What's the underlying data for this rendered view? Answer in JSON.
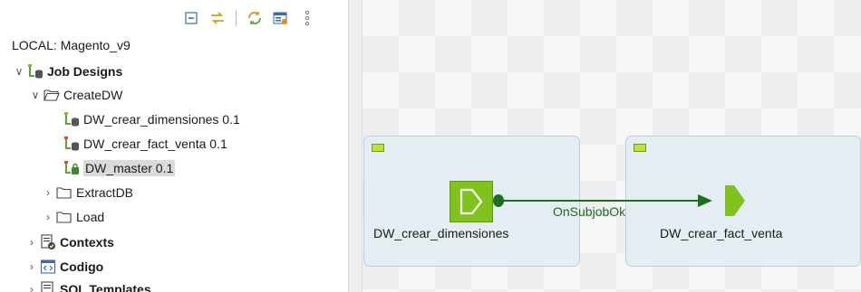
{
  "repository": {
    "project_label": "LOCAL: Magento_v9",
    "toolbar": [
      {
        "name": "collapse-all-icon"
      },
      {
        "name": "sync-link-icon"
      },
      {
        "name": "refresh-icon"
      },
      {
        "name": "view-menu-icon"
      },
      {
        "name": "more-options-icon"
      }
    ],
    "tree": [
      {
        "label": "Job Designs",
        "icon": "job-designs-icon",
        "bold": true,
        "expanded": true
      },
      {
        "label": "CreateDW",
        "icon": "folder-open-icon",
        "expanded": true
      },
      {
        "label": "DW_crear_dimensiones 0.1",
        "icon": "job-icon"
      },
      {
        "label": "DW_crear_fact_venta 0.1",
        "icon": "job-icon"
      },
      {
        "label": "DW_master 0.1",
        "icon": "job-locked-icon",
        "selected": true
      },
      {
        "label": "ExtractDB",
        "icon": "folder-icon",
        "expanded": false
      },
      {
        "label": "Load",
        "icon": "folder-icon",
        "expanded": false
      },
      {
        "label": "Contexts",
        "icon": "contexts-icon",
        "bold": true,
        "expanded": false
      },
      {
        "label": "Codigo",
        "icon": "code-icon",
        "bold": true,
        "expanded": false
      },
      {
        "label": "SQL Templates",
        "icon": "sql-templates-icon",
        "bold": true,
        "expanded": false
      }
    ]
  },
  "canvas": {
    "components": [
      {
        "label": "DW_crear_dimensiones",
        "selected": true
      },
      {
        "label": "DW_crear_fact_venta",
        "selected": false
      }
    ],
    "link": {
      "label": "OnSubjobOk",
      "color": "#1d6e1d"
    },
    "accent": "#7fc31c"
  }
}
